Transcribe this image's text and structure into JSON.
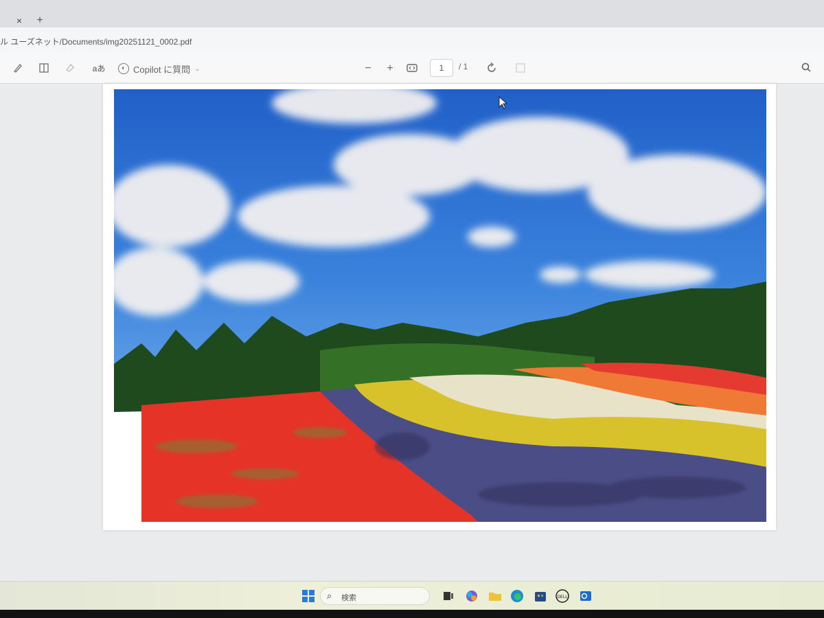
{
  "tabs": {
    "close_glyph": "×",
    "new_glyph": "+"
  },
  "address": {
    "path": "ル ユーズネット/Documents/img20251121_0002.pdf"
  },
  "toolbar": {
    "text_icon": "aあ",
    "copilot_label": "Copilot に質問",
    "zoom_out": "−",
    "zoom_in": "+",
    "page_current": "1",
    "page_total": "/ 1"
  },
  "taskbar": {
    "search_placeholder": "検索"
  },
  "colors": {
    "sky": "#2f74d0",
    "red_field": "#e8322a",
    "yellow_field": "#d9c62a",
    "purple_field": "#4a4a8a",
    "orange_field": "#f07830",
    "forest": "#1f4a1c"
  },
  "icons": [
    "draw-icon",
    "layout-icon",
    "erase-icon",
    "text-icon",
    "copilot-icon",
    "fit-page-icon",
    "rotate-icon",
    "search-icon",
    "windows-icon",
    "files-icon",
    "edge-icon",
    "store-icon",
    "dell-icon",
    "outlook-icon"
  ]
}
